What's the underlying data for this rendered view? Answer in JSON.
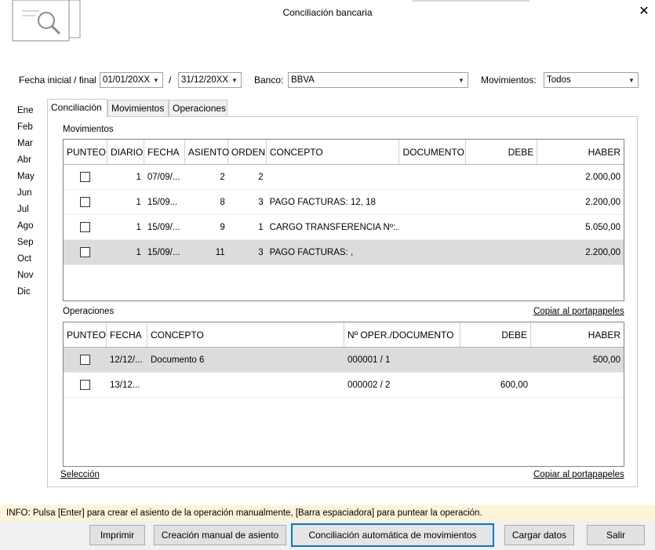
{
  "window": {
    "title": "Conciliación bancaria",
    "close_glyph": "✕"
  },
  "filters": {
    "fecha_label": "Fecha inicial / final",
    "fecha_inicial": "01/01/20XX",
    "separator": "/",
    "fecha_final": "31/12/20XX",
    "banco_label": "Banco:",
    "banco_value": "BBVA",
    "movimientos_label": "Movimientos:",
    "movimientos_value": "Todos"
  },
  "months": [
    "Ene",
    "Feb",
    "Mar",
    "Abr",
    "May",
    "Jun",
    "Jul",
    "Ago",
    "Sep",
    "Oct",
    "Nov",
    "Dic"
  ],
  "tabs": [
    "Conciliación",
    "Movimientos",
    "Operaciones"
  ],
  "movimientos": {
    "section_label": "Movimientos",
    "headers": [
      "PUNTEO",
      "DIARIO",
      "FECHA",
      "ASIENTO",
      "ORDEN",
      "CONCEPTO",
      "DOCUMENTO",
      "DEBE",
      "HABER"
    ],
    "rows": [
      {
        "diario": "1",
        "fecha": "07/09/...",
        "asiento": "2",
        "orden": "2",
        "concepto": "",
        "documento": "",
        "debe": "",
        "haber": "2.000,00"
      },
      {
        "diario": "1",
        "fecha": "15/09...",
        "asiento": "8",
        "orden": "3",
        "concepto": "PAGO FACTURAS: 12, 18",
        "documento": "",
        "debe": "",
        "haber": "2.200,00"
      },
      {
        "diario": "1",
        "fecha": "15/09/...",
        "asiento": "9",
        "orden": "1",
        "concepto": "CARGO TRANSFERENCIA Nº:...",
        "documento": "",
        "debe": "",
        "haber": "5.050,00"
      },
      {
        "diario": "1",
        "fecha": "15/09/...",
        "asiento": "11",
        "orden": "3",
        "concepto": "PAGO FACTURAS: ,",
        "documento": "",
        "debe": "",
        "haber": "2.200,00"
      }
    ]
  },
  "operaciones": {
    "section_label": "Operaciones",
    "copy_link": "Copiar al portapapeles",
    "headers": [
      "PUNTEO",
      "FECHA",
      "CONCEPTO",
      "Nº OPER./DOCUMENTO",
      "DEBE",
      "HABER"
    ],
    "rows": [
      {
        "fecha": "12/12/...",
        "concepto": "Documento 6",
        "documento": "000001 / 1",
        "debe": "",
        "haber": "500,00"
      },
      {
        "fecha": "13/12...",
        "concepto": "",
        "documento": "000002 / 2",
        "debe": "600,00",
        "haber": ""
      }
    ]
  },
  "footer_links": {
    "seleccion": "Selección",
    "copy": "Copiar al portapapeles"
  },
  "info": "INFO: Pulsa [Enter] para crear el asiento de la operación manualmente, [Barra espaciadora] para puntear la operación.",
  "buttons": {
    "imprimir": "Imprimir",
    "creacion": "Creación manual de asiento",
    "conciliacion": "Conciliación automática de movimientos",
    "cargar": "Cargar datos",
    "salir": "Salir"
  },
  "colors": {
    "info_bg": "#fdf3d7",
    "selected_row": "#dcdcdc",
    "focus_border": "#0078d7"
  }
}
